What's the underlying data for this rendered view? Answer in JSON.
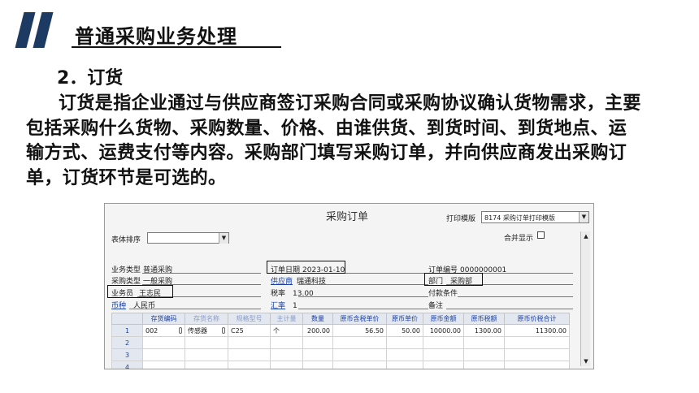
{
  "header": {
    "title": "普通采购业务处理"
  },
  "section": {
    "heading": "2．订货"
  },
  "paragraph": "订货是指企业通过与供应商签订采购合同或采购协议确认货物需求，主要包括采购什么货物、采购数量、价格、由谁供货、到货时间、到货地点、运输方式、运费支付等内容。采购部门填写采购订单，并向供应商发出采购订单，订货环节是可选的。",
  "window": {
    "title": "采购订单",
    "print_template_label": "打印模版",
    "print_template_value": "8174 采购订单打印模版",
    "sort_label": "表体排序",
    "merge_label": "合并显示"
  },
  "form": {
    "business_type": {
      "label": "业务类型",
      "value": "普通采购"
    },
    "purchase_type": {
      "label": "采购类型",
      "value": "一般采购"
    },
    "salesperson": {
      "label": "业务员",
      "value": "王志民"
    },
    "currency": {
      "label": "币种",
      "value": "人民币"
    },
    "order_date": {
      "label": "订单日期",
      "value": "2023-01-10"
    },
    "supplier": {
      "label": "供应商",
      "value": "瑞通科技"
    },
    "tax_rate": {
      "label": "税率",
      "value": "13.00"
    },
    "exchange_rate": {
      "label": "汇率",
      "value": "1"
    },
    "order_no": {
      "label": "订单编号",
      "value": "0000000001"
    },
    "department": {
      "label": "部门",
      "value": "采购部"
    },
    "payment_terms": {
      "label": "付款条件",
      "value": ""
    },
    "remarks": {
      "label": "备注",
      "value": ""
    }
  },
  "table": {
    "columns": [
      "",
      "存货编码",
      "存货名称",
      "规格型号",
      "主计量",
      "数量",
      "原币含税单价",
      "原币单价",
      "原币金额",
      "原币税额",
      "原币价税合计"
    ],
    "rows": [
      {
        "no": "1",
        "code": "002",
        "name": "传感器",
        "spec": "C25",
        "unit": "个",
        "qty": "200.00",
        "tax_price": "56.50",
        "price": "50.00",
        "amount": "10000.00",
        "tax": "1300.00",
        "total": "11300.00"
      },
      {
        "no": "2"
      },
      {
        "no": "3"
      },
      {
        "no": "4"
      }
    ]
  }
}
